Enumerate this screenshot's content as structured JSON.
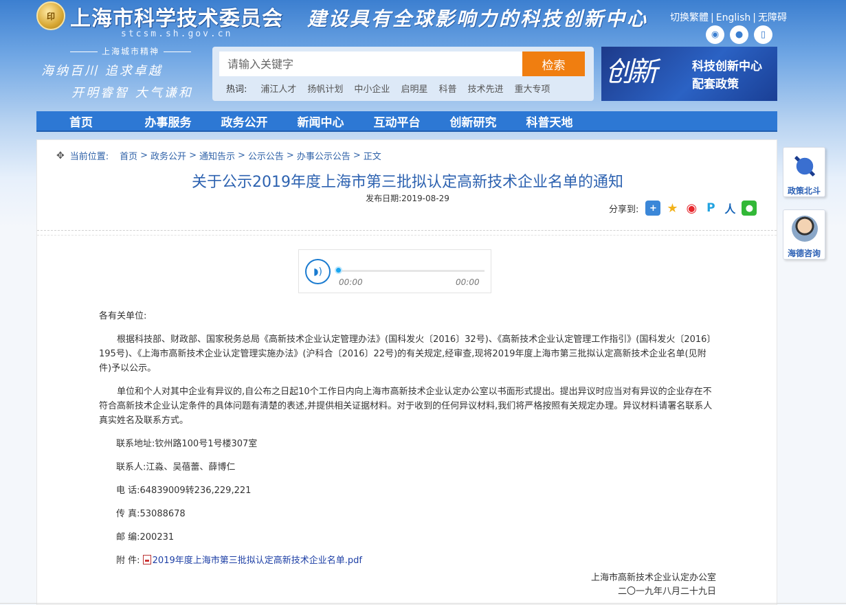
{
  "header": {
    "logo_emblem": "印",
    "site_title": "上海市科学技术委员会",
    "site_domain": "stcsm.sh.gov.cn",
    "slogan": "建设具有全球影响力的科技创新中心",
    "toplinks": [
      "切换繁體",
      "English",
      "无障碍"
    ],
    "toplinks_sep": "|",
    "social": [
      {
        "icon": "weibo-icon",
        "glyph": "◉"
      },
      {
        "icon": "wechat-icon",
        "glyph": "●"
      },
      {
        "icon": "mobile-icon",
        "glyph": "▯"
      }
    ],
    "spirit": {
      "heading": "上海城市精神",
      "line1": "海纳百川  追求卓越",
      "line2": "开明睿智  大气谦和"
    },
    "search": {
      "placeholder": "请输入关键字",
      "button": "检索",
      "hot_label": "热词:",
      "hot_words": [
        "浦江人才",
        "扬帆计划",
        "中小企业",
        "启明星",
        "科普",
        "技术先进",
        "重大专项"
      ]
    },
    "banner": {
      "big": "创新",
      "line1": "科技创新中心",
      "line2": "配套政策"
    }
  },
  "nav": [
    "首页",
    "办事服务",
    "政务公开",
    "新闻中心",
    "互动平台",
    "创新研究",
    "科普天地"
  ],
  "breadcrumb": {
    "label": "当前位置:",
    "items": [
      "首页",
      "政务公开",
      "通知告示",
      "公示公告",
      "办事公示公告",
      "正文"
    ],
    "sep": ">"
  },
  "article": {
    "title": "关于公示2019年度上海市第三批拟认定高新技术企业名单的通知",
    "pub_date": "发布日期:2019-08-29",
    "share_label": "分享到:",
    "share_icons": [
      {
        "name": "share-plus-icon",
        "glyph": "+",
        "color": "#3b87d8"
      },
      {
        "name": "share-qzone-icon",
        "glyph": "★",
        "color": "#f2b21b"
      },
      {
        "name": "share-weibo-icon",
        "glyph": "◉",
        "color": "#e6262c"
      },
      {
        "name": "share-pengyou-icon",
        "glyph": "P",
        "color": "#22a3e0"
      },
      {
        "name": "share-renren-icon",
        "glyph": "人",
        "color": "#1564b8"
      },
      {
        "name": "share-wechat-icon",
        "glyph": "●",
        "color": "#32b837"
      }
    ],
    "player": {
      "time_current": "00:00",
      "time_total": "00:00",
      "progress": 0
    },
    "salutation": "各有关单位:",
    "para1": "根据科技部、财政部、国家税务总局《高新技术企业认定管理办法》(国科发火〔2016〕32号)、《高新技术企业认定管理工作指引》(国科发火〔2016〕195号)、《上海市高新技术企业认定管理实施办法》(沪科合〔2016〕22号)的有关规定,经审查,现将2019年度上海市第三批拟认定高新技术企业名单(见附件)予以公示。",
    "para2": "单位和个人对其中企业有异议的,自公布之日起10个工作日内向上海市高新技术企业认定办公室以书面形式提出。提出异议时应当对有异议的企业存在不符合高新技术企业认定条件的具体问题有清楚的表述,并提供相关证据材料。对于收到的任何异议材料,我们将严格按照有关规定办理。异议材料请署名联系人真实姓名及联系方式。",
    "address": "联系地址:钦州路100号1号楼307室",
    "contacts": "联系人:江淼、吴蓓蕾、薛博仁",
    "phone": "电 话:64839009转236,229,221",
    "fax": "传 真:53088678",
    "postcode": "邮 编:200231",
    "attachment_label": "附 件:",
    "attachment": "2019年度上海市第三批拟认定高新技术企业名单.pdf",
    "sign_org": "上海市高新技术企业认定办公室",
    "sign_date": "二〇一九年八月二十九日"
  },
  "float": [
    {
      "label": "政策北斗",
      "icon": "policy-compass-icon"
    },
    {
      "label": "海德咨询",
      "icon": "consult-avatar-icon"
    }
  ],
  "colors": {
    "nav": "#2d78d4",
    "title": "#2d62b0",
    "search_button": "#f07e10",
    "link": "#1d3fa5"
  }
}
